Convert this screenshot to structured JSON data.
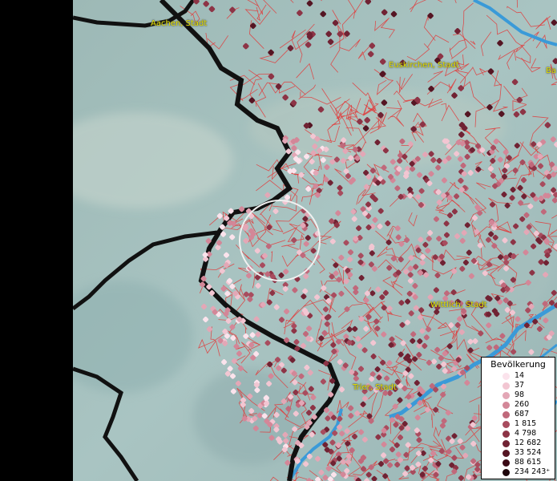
{
  "map": {
    "cities": [
      {
        "name": "Aachen, Stadt"
      },
      {
        "name": "Euskirchen, Stadt"
      },
      {
        "name": "Ba"
      },
      {
        "name": "Wittlich, Stadt"
      },
      {
        "name": "Trier, Stadt"
      }
    ]
  },
  "legend": {
    "title": "Bevölkerung",
    "classes": [
      {
        "label": "14",
        "color": "#fbe3ec"
      },
      {
        "label": "37",
        "color": "#f2c6d2"
      },
      {
        "label": "98",
        "color": "#e3a7b6"
      },
      {
        "label": "260",
        "color": "#d38798"
      },
      {
        "label": "687",
        "color": "#c0697b"
      },
      {
        "label": "1 815",
        "color": "#a84c5e"
      },
      {
        "label": "4 798",
        "color": "#8d3446"
      },
      {
        "label": "12 682",
        "color": "#702233"
      },
      {
        "label": "33 524",
        "color": "#551523"
      },
      {
        "label": "88 615",
        "color": "#3a0a15"
      },
      {
        "label": "234 243⁺",
        "color": "#1e050a"
      }
    ]
  },
  "colors": {
    "border": "#111111",
    "municipality_lines": "#e23a3a",
    "rivers": "#3a9ad8",
    "city_label": "#e8e400",
    "highlight_circle": "#f0f0f0"
  }
}
